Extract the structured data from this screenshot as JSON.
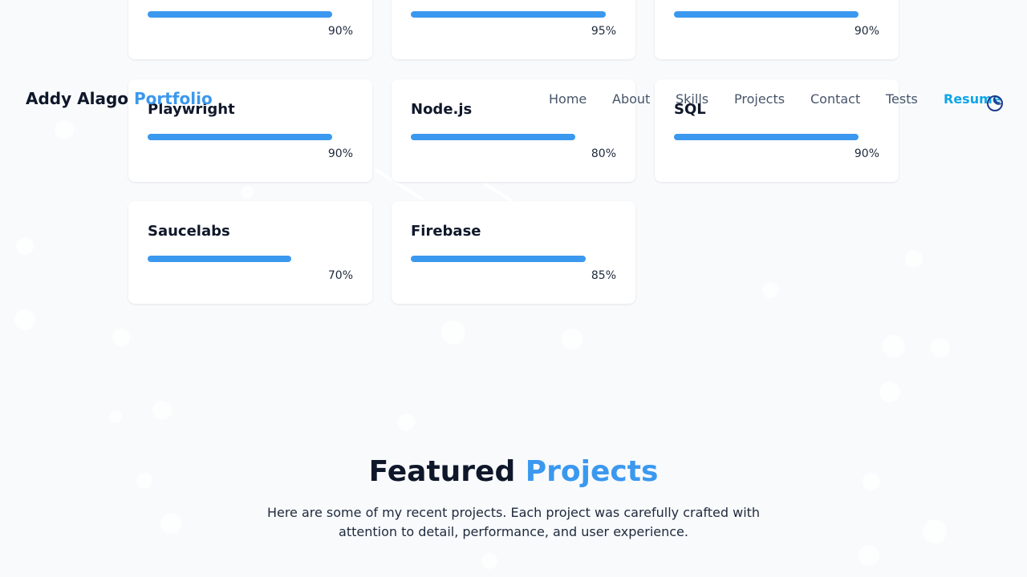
{
  "nav": {
    "brand_name": "Addy Alago",
    "brand_accent": "Portfolio",
    "links": [
      "Home",
      "About",
      "Skills",
      "Projects",
      "Contact",
      "Tests"
    ],
    "resume": "Resume",
    "theme_icon": "moon-icon"
  },
  "skills": [
    {
      "name": "",
      "level": 0.9,
      "percent": "90%"
    },
    {
      "name": "",
      "level": 0.95,
      "percent": "95%"
    },
    {
      "name": "",
      "level": 0.9,
      "percent": "90%"
    },
    {
      "name": "Playwright",
      "level": 0.9,
      "percent": "90%"
    },
    {
      "name": "Node.js",
      "level": 0.8,
      "percent": "80%"
    },
    {
      "name": "SQL",
      "level": 0.9,
      "percent": "90%"
    },
    {
      "name": "Saucelabs",
      "level": 0.7,
      "percent": "70%"
    },
    {
      "name": "Firebase",
      "level": 0.85,
      "percent": "85%"
    }
  ],
  "projects": {
    "title_main": "Featured",
    "title_accent": "Projects",
    "description": "Here are some of my recent projects. Each project was carefully crafted with attention to detail, performance, and user experience."
  },
  "colors": {
    "accent": "#3b98ef",
    "resume_link": "#0ea5e9",
    "background": "#f8fafc"
  }
}
